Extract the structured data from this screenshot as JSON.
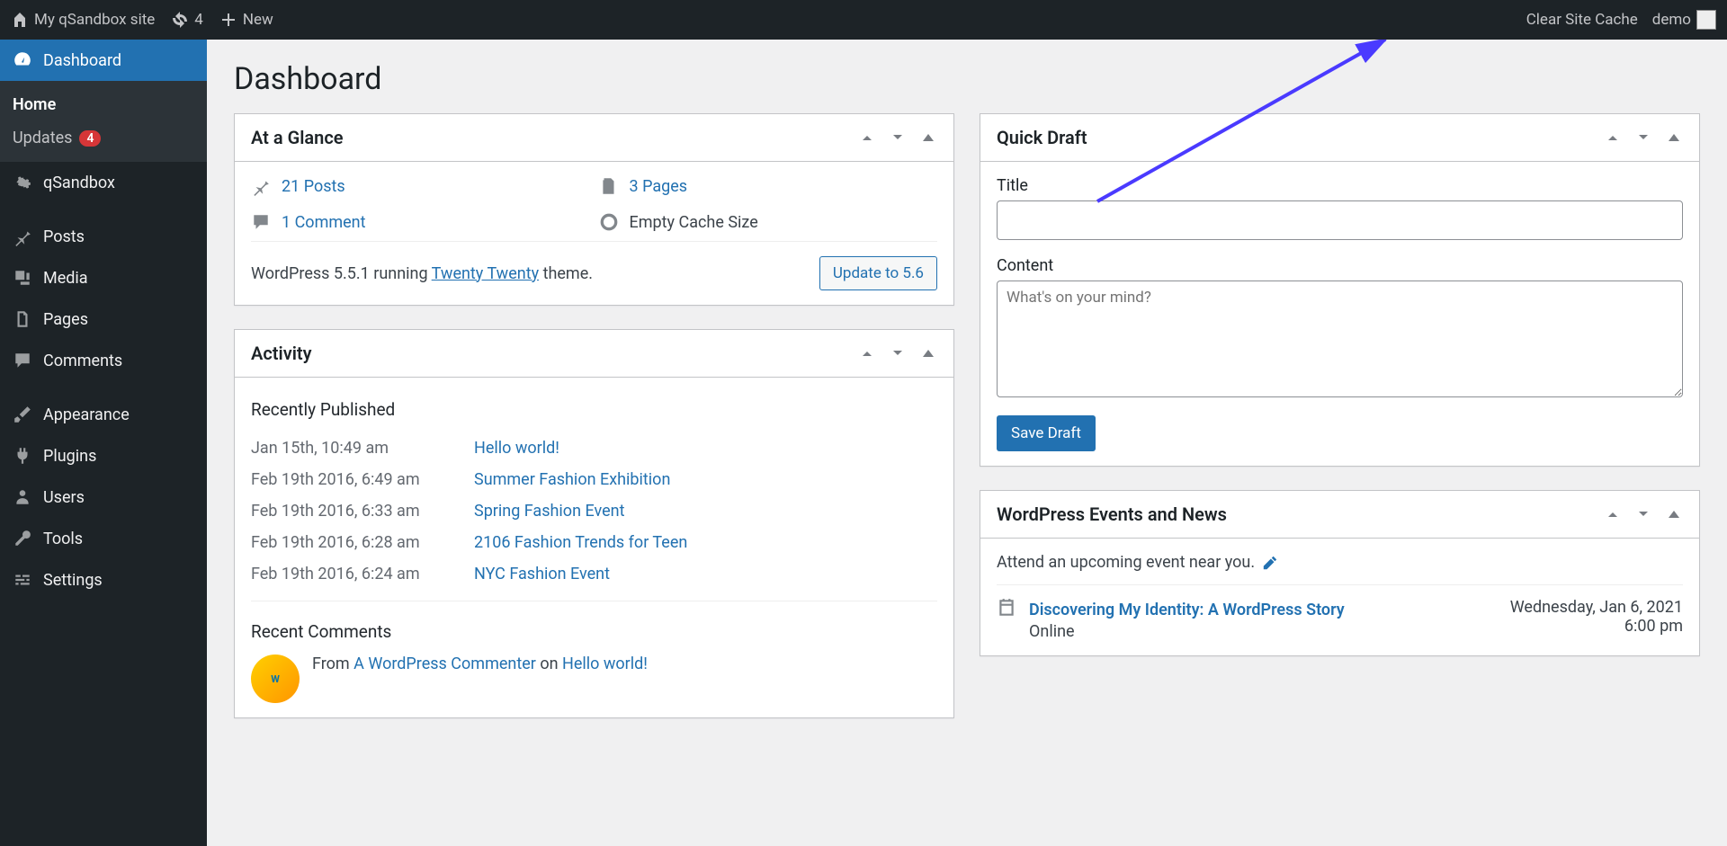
{
  "toolbar": {
    "site_name": "My qSandbox site",
    "updates_count": "4",
    "new_label": "New",
    "clear_cache": "Clear Site Cache",
    "user": "demo"
  },
  "sidebar": {
    "dashboard": "Dashboard",
    "submenu": {
      "home": "Home",
      "updates": "Updates",
      "updates_count": "4"
    },
    "items": [
      "qSandbox",
      "Posts",
      "Media",
      "Pages",
      "Comments",
      "Appearance",
      "Plugins",
      "Users",
      "Tools",
      "Settings"
    ]
  },
  "page": {
    "title": "Dashboard"
  },
  "glance": {
    "title": "At a Glance",
    "posts": "21 Posts",
    "pages": "3 Pages",
    "comments": "1 Comment",
    "cache": "Empty Cache Size",
    "version_pre": "WordPress 5.5.1 running ",
    "theme": "Twenty Twenty",
    "version_post": " theme.",
    "update_btn": "Update to 5.6"
  },
  "activity": {
    "title": "Activity",
    "recent_heading": "Recently Published",
    "rows": [
      {
        "date": "Jan 15th, 10:49 am",
        "title": "Hello world!"
      },
      {
        "date": "Feb 19th 2016, 6:49 am",
        "title": "Summer Fashion Exhibition"
      },
      {
        "date": "Feb 19th 2016, 6:33 am",
        "title": "Spring Fashion Event"
      },
      {
        "date": "Feb 19th 2016, 6:28 am",
        "title": "2106 Fashion Trends for Teen"
      },
      {
        "date": "Feb 19th 2016, 6:24 am",
        "title": "NYC Fashion Event"
      }
    ],
    "comments_heading": "Recent Comments",
    "comment": {
      "from": "From ",
      "author": "A WordPress Commenter",
      "on": " on ",
      "post": "Hello world!"
    }
  },
  "draft": {
    "title": "Quick Draft",
    "title_label": "Title",
    "content_label": "Content",
    "content_placeholder": "What's on your mind?",
    "save": "Save Draft"
  },
  "events": {
    "title": "WordPress Events and News",
    "intro": "Attend an upcoming event near you.",
    "item": {
      "title": "Discovering My Identity: A WordPress Story",
      "location": "Online",
      "date": "Wednesday, Jan 6, 2021",
      "time": "6:00 pm"
    }
  }
}
